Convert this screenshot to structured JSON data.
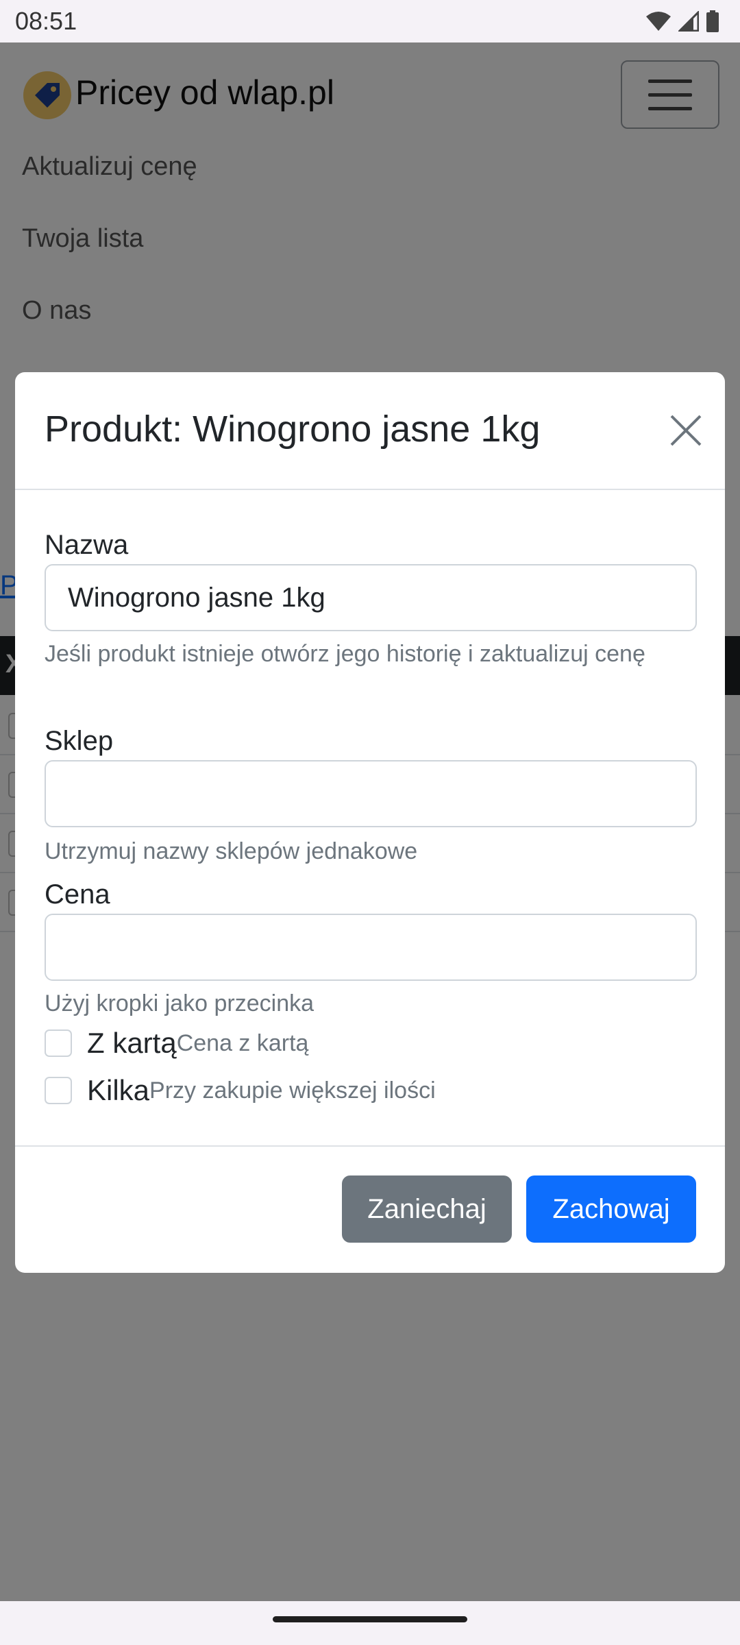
{
  "status_bar": {
    "time": "08:51"
  },
  "navbar": {
    "brand": "Pricey od wlap.pl",
    "links": [
      "Aktualizuj cenę",
      "Twoja lista",
      "O nas"
    ]
  },
  "page": {
    "link_stub": "P",
    "dark_bar_text": "X"
  },
  "modal": {
    "title": "Produkt: Winogrono jasne 1kg",
    "fields": {
      "name": {
        "label": "Nazwa",
        "value": "Winogrono jasne 1kg",
        "help": "Jeśli produkt istnieje otwórz jego historię i zaktualizuj cenę"
      },
      "shop": {
        "label": "Sklep",
        "value": "",
        "help": "Utrzymuj nazwy sklepów jednakowe"
      },
      "price": {
        "label": "Cena",
        "value": "",
        "help": "Użyj kropki jako przecinka"
      }
    },
    "checkboxes": [
      {
        "label": "Z kartą",
        "hint": "Cena z kartą",
        "checked": false
      },
      {
        "label": "Kilka",
        "hint": "Przy zakupie większej ilości",
        "checked": false
      }
    ],
    "buttons": {
      "cancel": "Zaniechaj",
      "save": "Zachowaj"
    }
  },
  "colors": {
    "primary": "#0d6efd",
    "secondary": "#6c757d",
    "backdrop": "rgba(0,0,0,0.5)"
  },
  "icons": {
    "close": "close-icon",
    "menu": "hamburger-icon",
    "logo": "price-tag-icon"
  }
}
